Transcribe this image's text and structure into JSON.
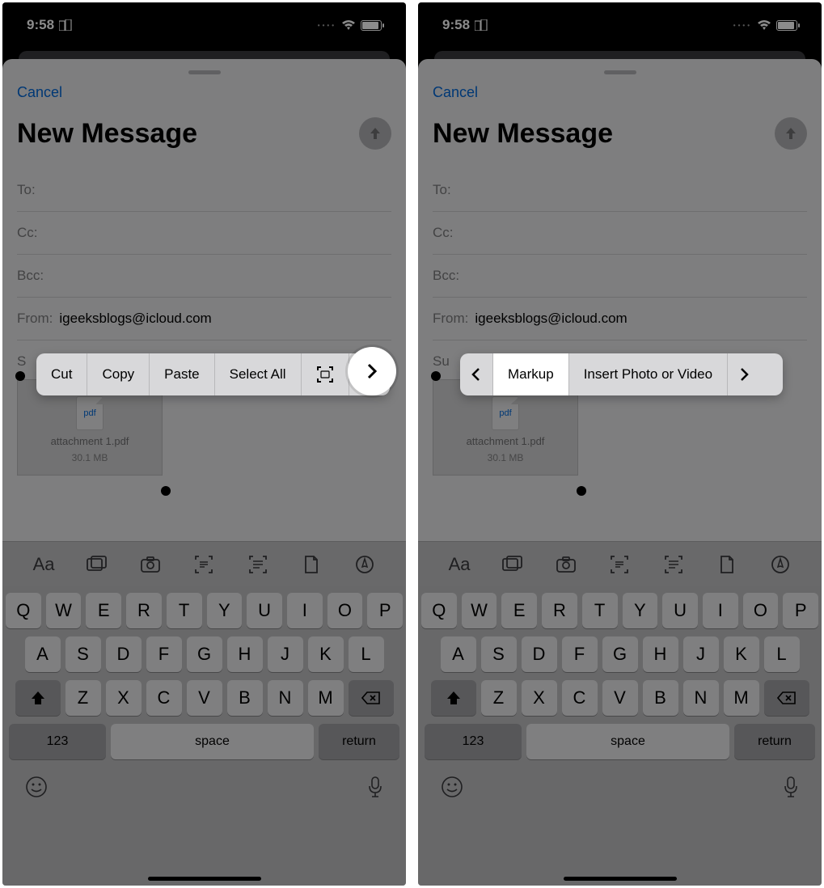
{
  "status": {
    "time": "9:58",
    "event_icon": "calendar-icon"
  },
  "compose": {
    "cancel": "Cancel",
    "title": "New Message",
    "fields": {
      "to": "To:",
      "cc": "Cc:",
      "bcc": "Bcc:",
      "from_label": "From:",
      "from_value": "igeeksblogs@icloud.com",
      "subject_prefix": "S"
    },
    "attachment": {
      "badge": "pdf",
      "filename": "attachment 1.pdf",
      "filesize": "30.1 MB"
    }
  },
  "context_menu_1": {
    "items": [
      "Cut",
      "Copy",
      "Paste",
      "Select All"
    ],
    "icons": [
      "scan-icon"
    ],
    "has_next": true
  },
  "context_menu_2": {
    "has_prev": true,
    "items": [
      "Markup",
      "Insert Photo or Video"
    ],
    "has_next": true,
    "highlighted": "Markup"
  },
  "format_bar": [
    "Aa",
    "photos-icon",
    "camera-icon",
    "scan-text-icon",
    "list-icon",
    "document-icon",
    "markup-icon"
  ],
  "keyboard": {
    "row1": [
      "Q",
      "W",
      "E",
      "R",
      "T",
      "Y",
      "U",
      "I",
      "O",
      "P"
    ],
    "row2": [
      "A",
      "S",
      "D",
      "F",
      "G",
      "H",
      "J",
      "K",
      "L"
    ],
    "row3": [
      "Z",
      "X",
      "C",
      "V",
      "B",
      "N",
      "M"
    ],
    "numeric": "123",
    "space": "space",
    "return": "return"
  }
}
